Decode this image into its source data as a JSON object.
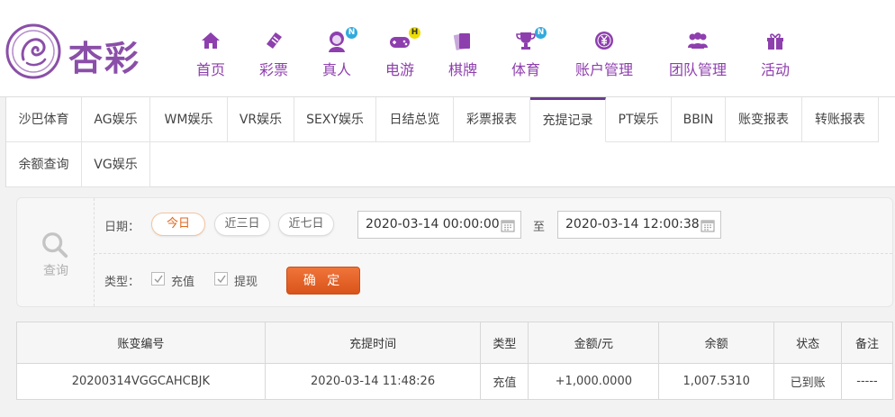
{
  "brand": {
    "name": "杏彩"
  },
  "nav": [
    {
      "label": "首页",
      "icon": "home-icon"
    },
    {
      "label": "彩票",
      "icon": "lottery-ticket-icon"
    },
    {
      "label": "真人",
      "icon": "live-dealer-icon",
      "badge": "N"
    },
    {
      "label": "电游",
      "icon": "gamepad-icon",
      "badge": "H"
    },
    {
      "label": "棋牌",
      "icon": "cards-icon"
    },
    {
      "label": "体育",
      "icon": "trophy-icon",
      "badge": "N"
    },
    {
      "label": "账户管理",
      "icon": "yen-coin-icon"
    },
    {
      "label": "团队管理",
      "icon": "team-icon"
    },
    {
      "label": "活动",
      "icon": "gift-icon"
    }
  ],
  "tabs": [
    {
      "label": "沙巴体育"
    },
    {
      "label": "AG娱乐"
    },
    {
      "label": "WM娱乐"
    },
    {
      "label": "VR娱乐"
    },
    {
      "label": "SEXY娱乐"
    },
    {
      "label": "日结总览"
    },
    {
      "label": "彩票报表"
    },
    {
      "label": "充提记录",
      "active": true
    },
    {
      "label": "PT娱乐"
    },
    {
      "label": "BBIN"
    },
    {
      "label": "账变报表"
    },
    {
      "label": "转账报表"
    },
    {
      "label": "余额查询"
    },
    {
      "label": "VG娱乐"
    }
  ],
  "query": {
    "side_label": "查询",
    "date_label": "日期：",
    "quick_ranges": [
      "今日",
      "近三日",
      "近七日"
    ],
    "active_range": "今日",
    "start_date": "2020-03-14 00:00:00",
    "to_label": "至",
    "end_date": "2020-03-14 12:00:38",
    "type_label": "类型：",
    "types": [
      {
        "label": "充值",
        "checked": true
      },
      {
        "label": "提现",
        "checked": true
      }
    ],
    "confirm_label": "确 定"
  },
  "table": {
    "columns": [
      "账变编号",
      "充提时间",
      "类型",
      "金额/元",
      "余额",
      "状态",
      "备注"
    ],
    "rows": [
      [
        "20200314VGGCAHCBJK",
        "2020-03-14 11:48:26",
        "充值",
        "+1,000.0000",
        "1,007.5310",
        "已到账",
        "-----"
      ]
    ]
  },
  "colors": {
    "brand_purple": "#8e3fae",
    "accent_orange": "#e2661e",
    "amount_red": "#d0021b",
    "status_green": "#2fa44f"
  }
}
